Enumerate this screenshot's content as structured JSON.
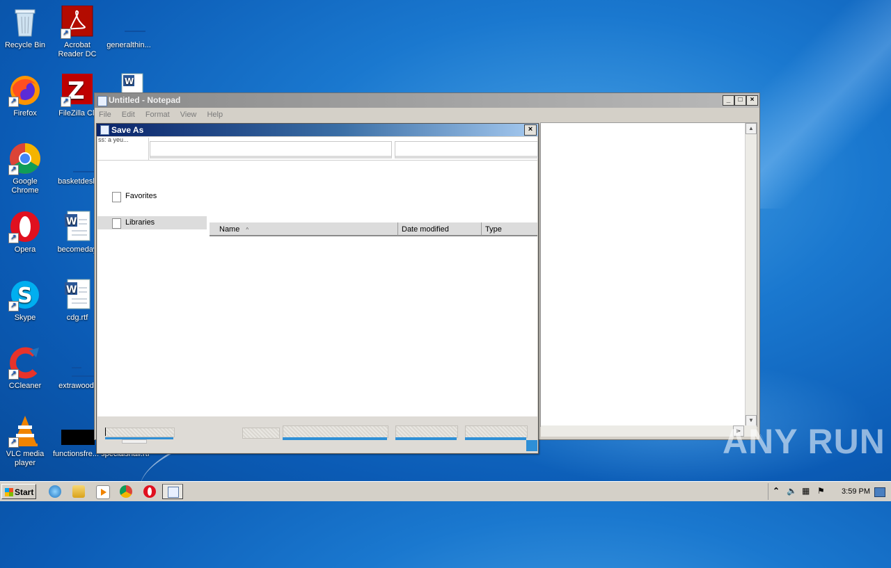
{
  "desktop": {
    "icons": [
      {
        "label": "Recycle Bin"
      },
      {
        "label": "Acrobat Reader DC"
      },
      {
        "label": "generalthin..."
      },
      {
        "label": "Firefox"
      },
      {
        "label": "FileZilla Cli"
      },
      {
        "label": "Google Chrome"
      },
      {
        "label": "basketdesk"
      },
      {
        "label": "Opera"
      },
      {
        "label": "becomeday"
      },
      {
        "label": "Skype"
      },
      {
        "label": "cdg.rtf"
      },
      {
        "label": "CCleaner"
      },
      {
        "label": "extrawood."
      },
      {
        "label": "VLC media player"
      },
      {
        "label": "functionsfre... specialshall.rtf"
      }
    ]
  },
  "notepad": {
    "title": "Untitled - Notepad",
    "menu": [
      "File",
      "Edit",
      "Format",
      "View",
      "Help"
    ],
    "min": "_",
    "max": "□",
    "close": "×"
  },
  "save_as": {
    "title": "Save As",
    "close": "×",
    "address_partial": "ss: a yeu...",
    "address_value": "",
    "search_value": "",
    "nav": [
      "Favorites",
      "Libraries"
    ],
    "columns": [
      "Name",
      "Date modified",
      "Type"
    ],
    "sort_indicator": "^"
  },
  "taskbar": {
    "start_label": "Start",
    "clock": "3:59 PM"
  },
  "watermark": "ANY RUN",
  "colors": {
    "desktop_accent": "#1a78cf",
    "dialog_title_start": "#0a246a",
    "progress_blue": "#2e8fd6"
  }
}
